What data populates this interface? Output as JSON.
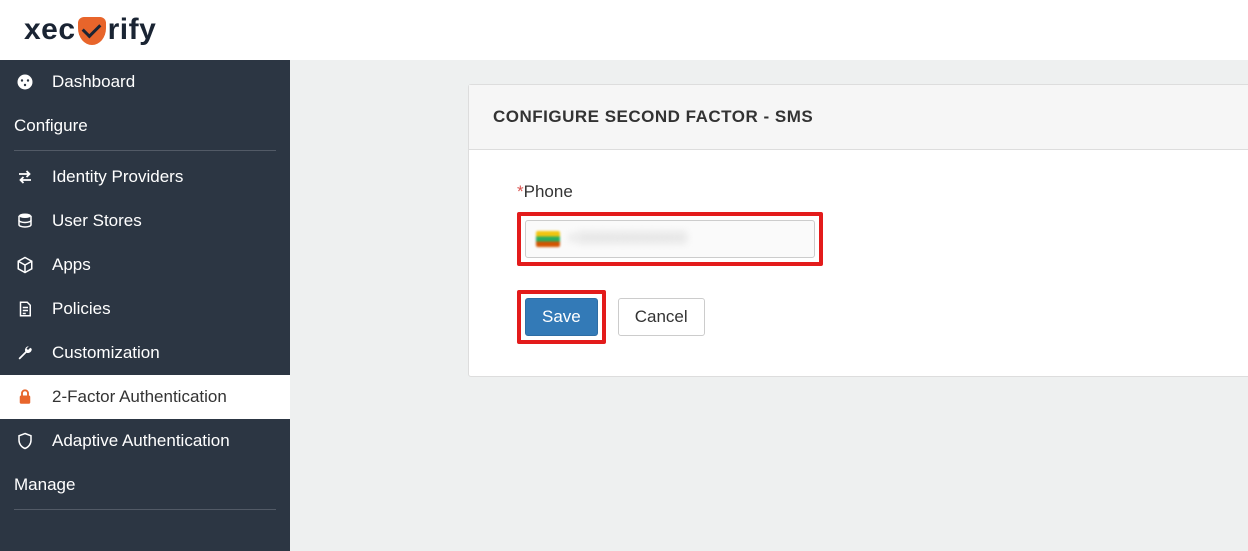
{
  "brand": {
    "pre": "xec",
    "post": "rify"
  },
  "sidebar": {
    "items": [
      {
        "label": "Dashboard",
        "icon": "dashboard"
      },
      {
        "label": "Configure",
        "section": true
      },
      {
        "label": "Identity Providers",
        "icon": "transfer"
      },
      {
        "label": "User Stores",
        "icon": "database"
      },
      {
        "label": "Apps",
        "icon": "cube"
      },
      {
        "label": "Policies",
        "icon": "policy"
      },
      {
        "label": "Customization",
        "icon": "wrench"
      },
      {
        "label": "2-Factor Authentication",
        "icon": "lock",
        "active": true
      },
      {
        "label": "Adaptive Authentication",
        "icon": "shield"
      },
      {
        "label": "Manage",
        "section": true
      }
    ]
  },
  "card": {
    "heading": "CONFIGURE SECOND FACTOR - SMS",
    "phone_label": "Phone",
    "required_mark": "*",
    "phone_value_masked": "+00000000000",
    "save_label": "Save",
    "cancel_label": "Cancel"
  },
  "colors": {
    "accent_orange": "#e8652b",
    "highlight_red": "#e31b1b"
  }
}
